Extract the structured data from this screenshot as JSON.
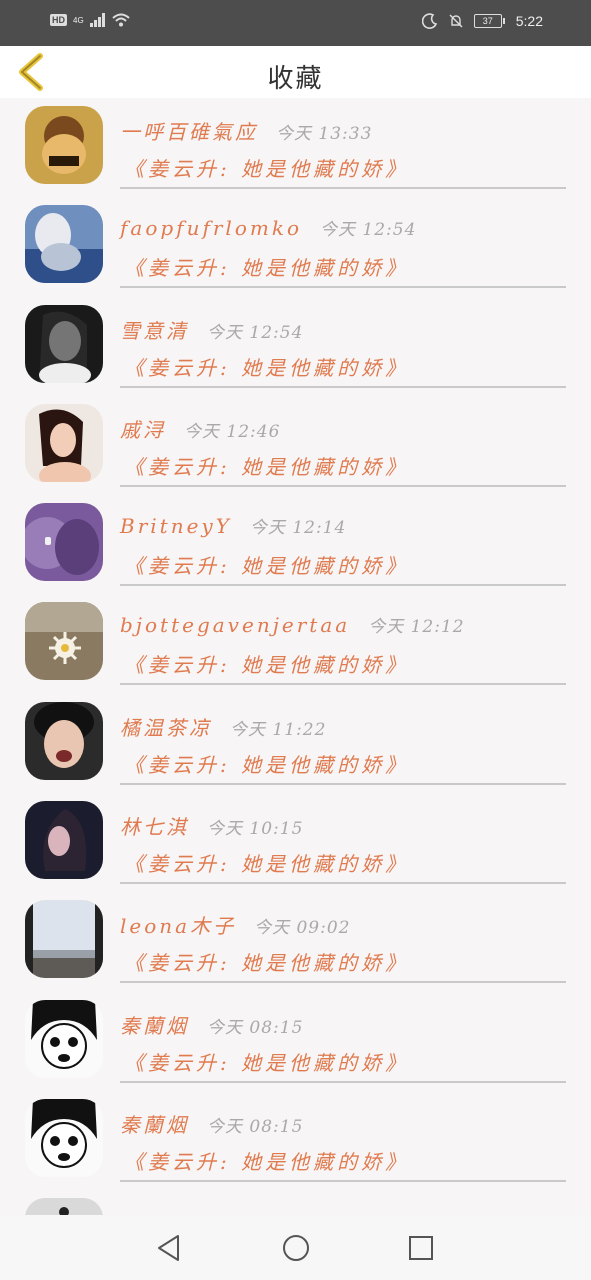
{
  "status_bar": {
    "network": "4G",
    "badge": "HD",
    "battery": "37",
    "time": "5:22"
  },
  "header": {
    "title": "收藏"
  },
  "items": [
    {
      "name": "一呼百碓氣应",
      "time": "今天 13:33",
      "book": "《姜云升: 她是他藏的娇》"
    },
    {
      "name": "faopfufrlomko",
      "time": "今天 12:54",
      "book": "《姜云升: 她是他藏的娇》"
    },
    {
      "name": "雪意清",
      "time": "今天 12:54",
      "book": "《姜云升: 她是他藏的娇》"
    },
    {
      "name": "戚浔",
      "time": "今天 12:46",
      "book": "《姜云升: 她是他藏的娇》"
    },
    {
      "name": "BritneyY",
      "time": "今天 12:14",
      "book": "《姜云升: 她是他藏的娇》"
    },
    {
      "name": "bjottegavenjertaa",
      "time": "今天 12:12",
      "book": "《姜云升: 她是他藏的娇》"
    },
    {
      "name": "橘温茶凉",
      "time": "今天 11:22",
      "book": "《姜云升: 她是他藏的娇》"
    },
    {
      "name": "林七淇",
      "time": "今天 10:15",
      "book": "《姜云升: 她是他藏的娇》"
    },
    {
      "name": "leona木子",
      "time": "今天 09:02",
      "book": "《姜云升: 她是他藏的娇》"
    },
    {
      "name": "秦蘭烟",
      "time": "今天 08:15",
      "book": "《姜云升: 她是他藏的娇》"
    },
    {
      "name": "秦蘭烟",
      "time": "今天 08:15",
      "book": "《姜云升: 她是他藏的娇》"
    }
  ],
  "colors": {
    "accent": "#e07b50",
    "time": "#a9a9a9",
    "back_arrow": "#e8c43a"
  }
}
